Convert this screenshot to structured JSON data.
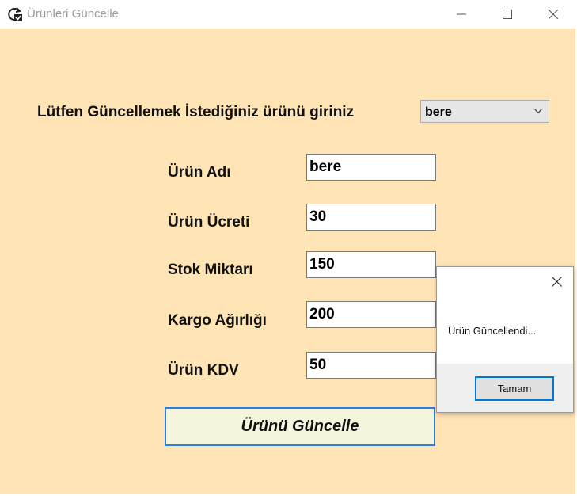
{
  "window": {
    "title": "Ürünleri Güncelle",
    "icon": "refresh-check-icon",
    "controls": [
      "minimize-icon",
      "maximize-icon",
      "close-icon"
    ]
  },
  "form": {
    "prompt": "Lütfen Güncellemek İstediğiniz ürünü giriniz",
    "product_select": {
      "selected": "bere"
    },
    "fields": [
      {
        "label": "Ürün Adı",
        "value": "bere"
      },
      {
        "label": "Ürün Ücreti",
        "value": "30"
      },
      {
        "label": "Stok Miktarı",
        "value": "150"
      },
      {
        "label": "Kargo Ağırlığı",
        "value": "200"
      },
      {
        "label": "Ürün KDV",
        "value": "50"
      }
    ],
    "update_button": "Ürünü Güncelle"
  },
  "dialog": {
    "message": "Ürün Güncellendi...",
    "ok_button": "Tamam"
  },
  "colors": {
    "form_background": "#ffe4b5",
    "button_background": "#f5f4dc",
    "focus_border": "#2b7fd4"
  }
}
